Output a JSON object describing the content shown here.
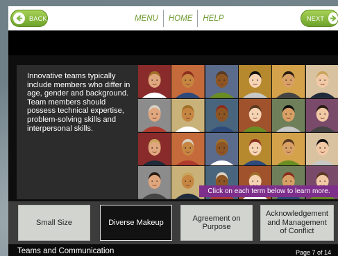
{
  "nav": {
    "back_label": "BACK",
    "next_label": "NEXT",
    "menu_label": "MENU",
    "home_label": "HOME",
    "help_label": "HELP",
    "accent_color": "#7cb342"
  },
  "intro_text": "Innovative teams typically include members who differ in age, gender and background. Team members should possess technical expertise, problem-solving skills and interpersonal skills.",
  "photo": {
    "caption": "Click on each term below to learn more.",
    "caption_color": "#7e2f8b"
  },
  "terms": [
    {
      "label": "Small Size",
      "selected": false
    },
    {
      "label": "Diverse Makeup",
      "selected": true
    },
    {
      "label": "Agreement on Purpose",
      "selected": false
    },
    {
      "label": "Acknowledgement and Management of Conflict",
      "selected": false
    }
  ],
  "footer": {
    "course_title": "Teams and Communication",
    "page_label": "Page 7 of 14"
  }
}
